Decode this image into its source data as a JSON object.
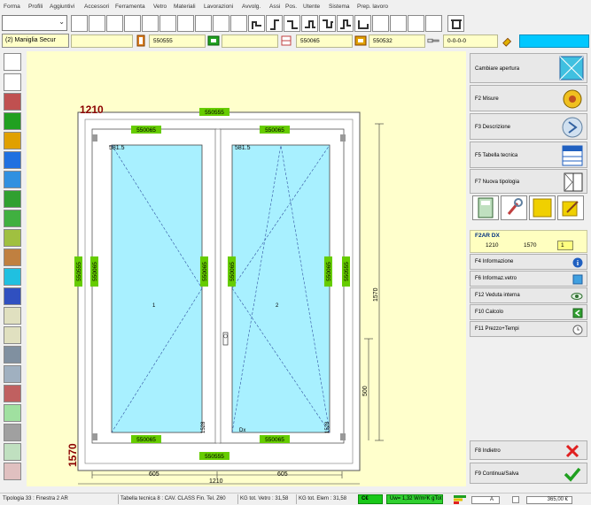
{
  "menu": [
    "Forma",
    "Profili",
    "Aggiuntivi",
    "Accessori",
    "Ferramenta",
    "Vetro",
    "Materiali",
    "Lavorazioni",
    "Avvolg.",
    "Assi",
    "Pos.",
    "Utente",
    "Sistema",
    "Prep. lavoro"
  ],
  "toolbar2": {
    "selector_label": "(2) Maniglia Secur",
    "codes": [
      "550555",
      "550065",
      "550532",
      "0-0-0-0"
    ]
  },
  "drawing": {
    "overall_width": "1210",
    "overall_height": "1570",
    "code_frame": "550555",
    "code_sash": "550065",
    "sash_width_left": "581.5",
    "sash_width_right": "581.5",
    "glass_label_left": "1",
    "glass_label_right": "2",
    "dim_height_inner": "1570",
    "dim_handle": "500",
    "dim_bottom_left": "605",
    "dim_bottom_right": "605",
    "dim_bottom_total": "1210",
    "sash_height_left": "1528",
    "sash_height_right": "1528",
    "opening_side": "Dx"
  },
  "right_panel": {
    "change_opening": "Cambiare apertura",
    "measures": "F2 Misure",
    "description": "F3 Descrizione",
    "tech_table": "F5 Tabella tecnica",
    "new_type": "F7 Nuova tipologia",
    "type_code": "F2AR DX",
    "type_width": "1210",
    "type_height": "1570",
    "type_qty": "1",
    "info": "F4 Informazione",
    "glass_info": "F6 Informaz.vetro",
    "inner_view": "F12 Veduta interna",
    "calc": "F10 Calcolo",
    "price_time": "F11 Prezzo+Tempi",
    "back": "F8 Indietro",
    "save": "F9 Continua/Salva"
  },
  "status": {
    "typology": "Tipologia 33 : Finestra 2 AR",
    "tech_table": "Tabella tecnica 8 : CAV. CLASS Fin. Tel. Z60",
    "kg_glass": "KG tot. Vetro : 31,58",
    "kg_elem": "KG tot. Elem : 31,58",
    "ce": "C€",
    "uw": "Uw= 1,32 W/m²K gTot",
    "class": "A",
    "price": "365,00 €"
  },
  "colors": {
    "canvas": "#ffffcc",
    "glass": "#a8f0ff",
    "label_green": "#66cc00",
    "dim_red": "#8b0000",
    "accent_cyan": "#00c8ff"
  }
}
